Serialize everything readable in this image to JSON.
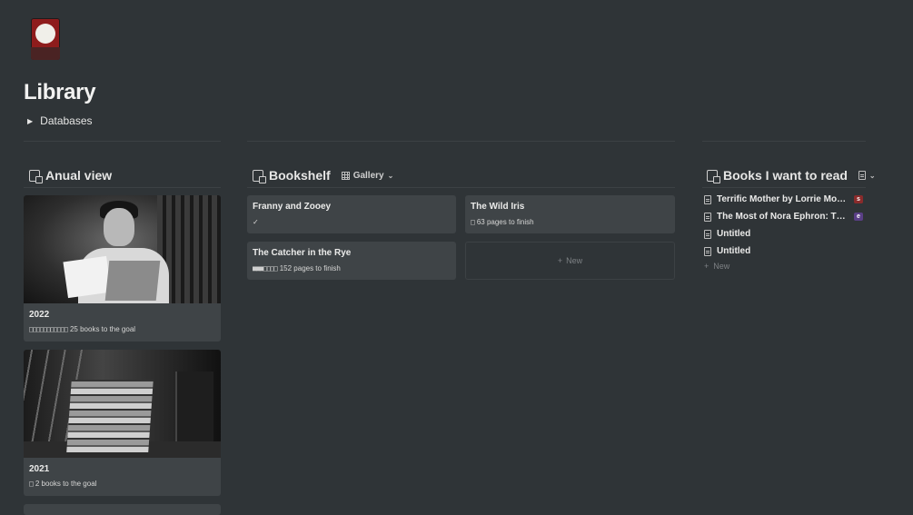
{
  "page": {
    "title": "Library",
    "toggle_label": "Databases"
  },
  "annual": {
    "title": "Anual view",
    "cards": [
      {
        "year": "2022",
        "boxes": "□□□□□□□□□□□",
        "goal_text": "25 books to the goal"
      },
      {
        "year": "2021",
        "boxes": "□",
        "goal_text": "2 books to the goal"
      }
    ]
  },
  "bookshelf": {
    "title": "Bookshelf",
    "view_label": "Gallery",
    "cards": [
      {
        "title": "Franny and Zooey",
        "prop": "✓",
        "boxes": ""
      },
      {
        "title": "The Wild Iris",
        "boxes": "□",
        "prop": "63 pages to finish"
      },
      {
        "title": "The Catcher in the Rye",
        "boxes": "■■■□□□□",
        "prop": "152 pages to finish"
      }
    ],
    "new_label": "New"
  },
  "want": {
    "title": "Books I want to read",
    "items": [
      {
        "label": "Terrific Mother by Lorrie Moo...",
        "tag": "s",
        "tag_color": "#8a2b2b"
      },
      {
        "label": "The Most of Nora Ephron: Th...",
        "tag": "e",
        "tag_color": "#5a3f86"
      },
      {
        "label": "Untitled"
      },
      {
        "label": "Untitled"
      }
    ],
    "new_label": "New"
  }
}
